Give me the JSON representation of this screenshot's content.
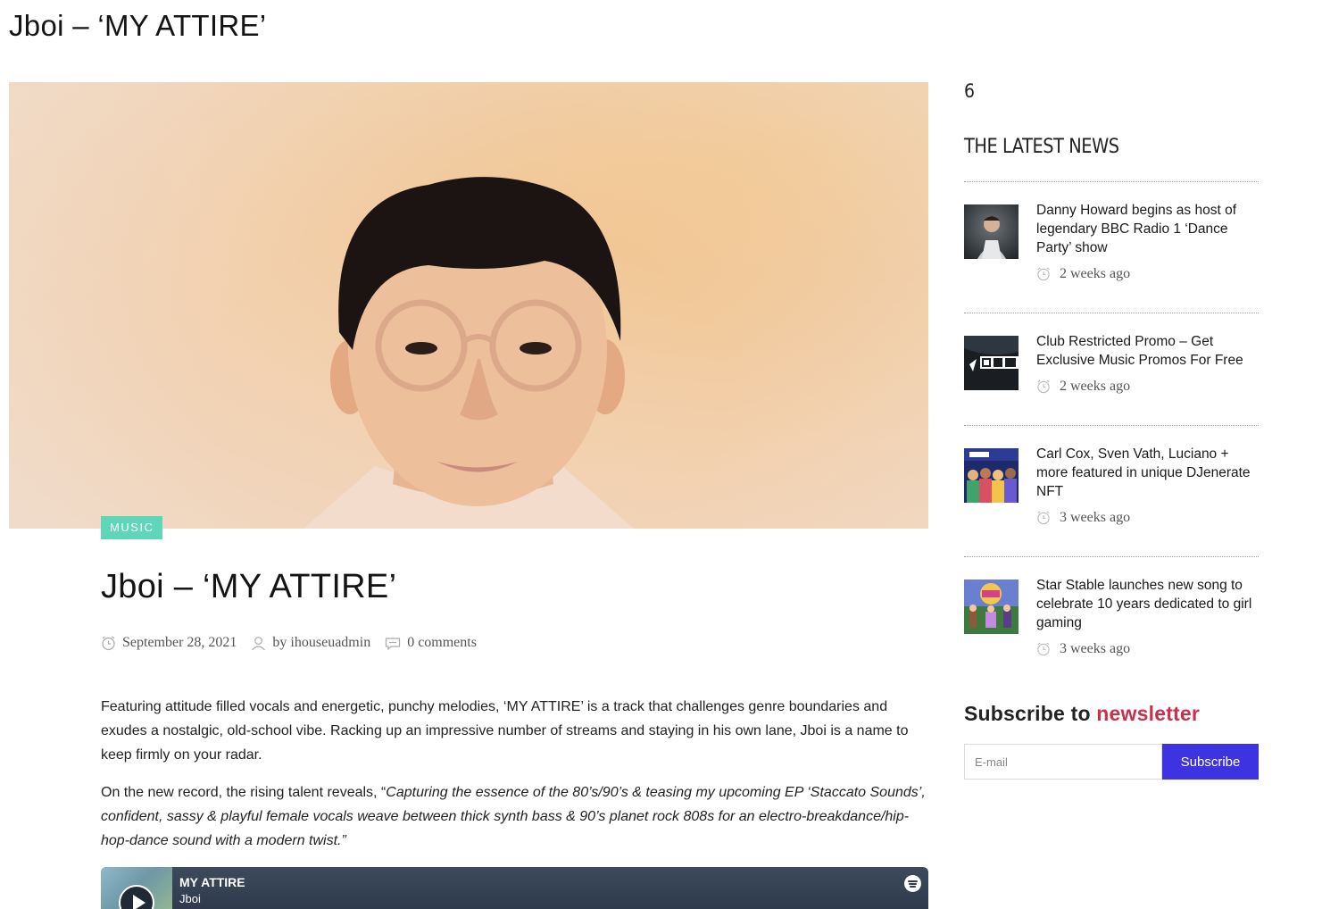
{
  "page": {
    "title": "Jboi – ‘MY ATTIRE’"
  },
  "article": {
    "category": "MUSIC",
    "title": "Jboi – ‘MY ATTIRE’",
    "date": "September 28, 2021",
    "author": "by ihouseuadmin",
    "comments": "0 comments",
    "paragraph1": "Featuring attitude filled vocals and energetic, punchy melodies, ‘MY ATTIRE’ is a track that challenges genre boundaries and exudes a nostalgic, old-school vibe. Racking up an impressive number of streams and staying in his own lane, Jboi is a name to keep firmly on your radar.",
    "paragraph2_lead": "On the new record, the rising talent reveals, “",
    "paragraph2_quote": "Capturing the essence of the 80’s/90’s & teasing my upcoming EP ‘Staccato Sounds’, confident, sassy & playful female vocals weave between thick synth bass & 90’s planet rock 808s for an electro-breakdance/hip-hop-dance sound with a modern twist.”"
  },
  "player": {
    "track": "MY ATTIRE",
    "artist": "Jboi",
    "service_icon": "spotify-icon"
  },
  "sidebar": {
    "number": "6",
    "heading": "THE LATEST NEWS",
    "news": [
      {
        "title": "Danny Howard begins as host of legendary BBC Radio 1 ‘Dance Party’ show",
        "time": "2 weeks ago"
      },
      {
        "title": "Club Restricted Promo – Get Exclusive Music Promos For Free",
        "time": "2 weeks ago"
      },
      {
        "title": "Carl Cox, Sven Vath, Luciano + more featured in unique DJenerate NFT",
        "time": "3 weeks ago"
      },
      {
        "title": "Star Stable launches new song to celebrate 10 years dedicated to girl gaming",
        "time": "3 weeks ago"
      }
    ],
    "subscribe": {
      "title_prefix": "Subscribe to ",
      "title_accent": "newsletter",
      "email_placeholder": "E-mail",
      "button_label": "Subscribe"
    }
  },
  "colors": {
    "badge": "#5fd6b8",
    "accent": "#c9304b",
    "subscribe_button": "#3d33e0"
  }
}
